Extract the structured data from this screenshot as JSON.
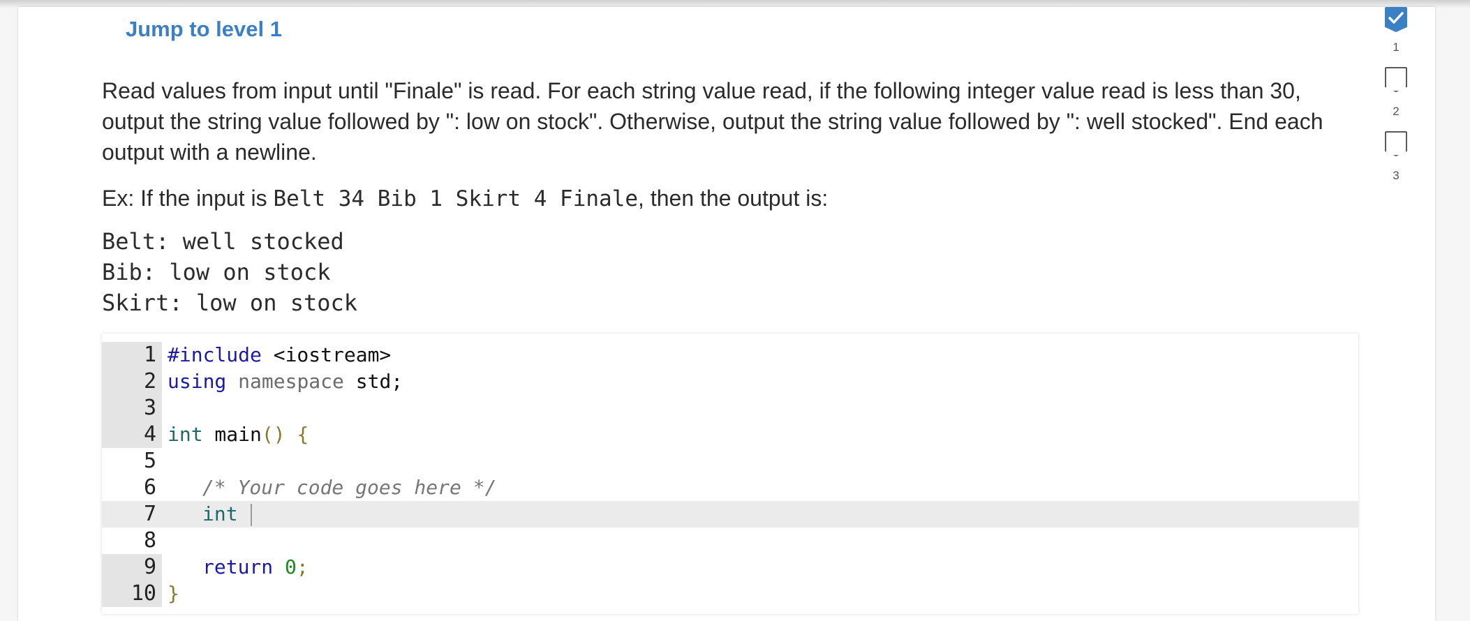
{
  "jump_link": "Jump to level 1",
  "prompt": "Read values from input until \"Finale\" is read. For each string value read, if the following integer value read is less than 30, output the string value followed by \": low on stock\". Otherwise, output the string value followed by \": well stocked\". End each output with a newline.",
  "example": {
    "prefix": "Ex: If the input is ",
    "input": "Belt 34 Bib 1 Skirt 4 Finale",
    "suffix": ", then the output is:"
  },
  "output_lines": [
    "Belt: well stocked",
    "Bib: low on stock",
    "Skirt: low on stock"
  ],
  "editor": {
    "line_numbers": [
      "1",
      "2",
      "3",
      "4",
      "5",
      "6",
      "7",
      "8",
      "9",
      "10"
    ],
    "lines": {
      "l1_kw": "#include",
      "l1_rest": " <iostream>",
      "l2_kw": "using",
      "l2_ns": "namespace",
      "l2_rest": " std;",
      "l4_type": "int",
      "l4_name": " main",
      "l4_parens": "()",
      "l4_brace": " {",
      "l6_comment": "/* Your code goes here */",
      "l7_type": "int",
      "l9_kw": "return",
      "l9_num": "0",
      "l9_semi": ";",
      "l10_brace": "}"
    }
  },
  "levels": {
    "items": [
      {
        "label": "1",
        "completed": true
      },
      {
        "label": "2",
        "completed": false
      },
      {
        "label": "3",
        "completed": false
      }
    ]
  }
}
